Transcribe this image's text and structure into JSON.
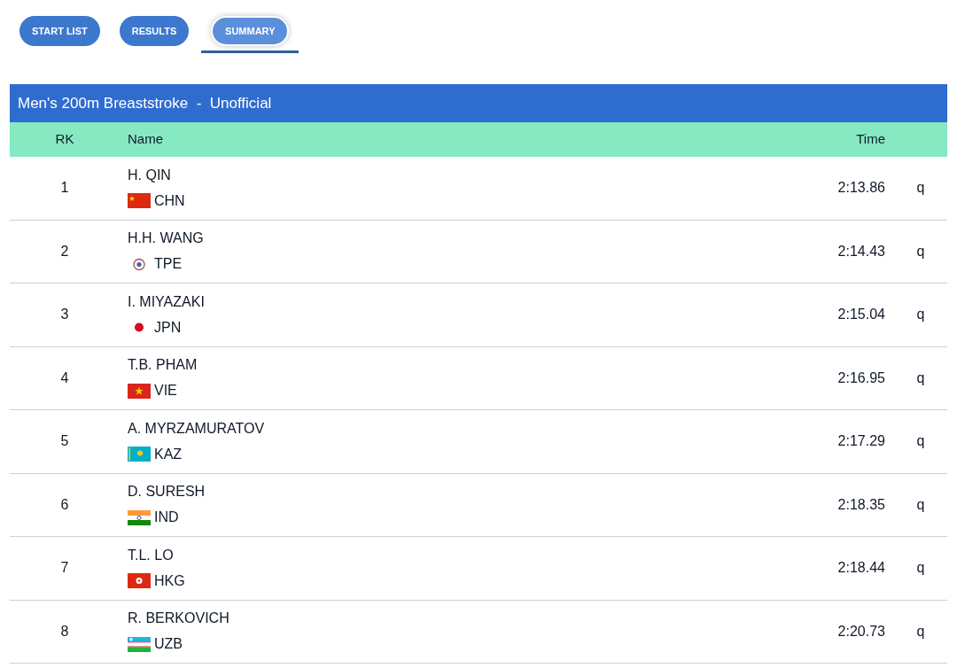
{
  "tabs": [
    {
      "label": "START LIST",
      "selected": false
    },
    {
      "label": "RESULTS",
      "selected": false
    },
    {
      "label": "SUMMARY",
      "selected": true
    }
  ],
  "table": {
    "title": "Men's 200m Breaststroke  -  Unofficial",
    "columns": [
      "RK",
      "Name",
      "Time"
    ],
    "rows": [
      {
        "rank": "1",
        "name": "H. QIN",
        "kind": "chn",
        "country": "CHN",
        "time": "2:13.86",
        "qualifier": "q"
      },
      {
        "rank": "2",
        "name": "H.H. WANG",
        "kind": "tpe",
        "country": "TPE",
        "time": "2:14.43",
        "qualifier": "q"
      },
      {
        "rank": "3",
        "name": "I. MIYAZAKI",
        "kind": "jpn",
        "country": "JPN",
        "time": "2:15.04",
        "qualifier": "q"
      },
      {
        "rank": "4",
        "name": "T.B. PHAM",
        "kind": "vie",
        "country": "VIE",
        "time": "2:16.95",
        "qualifier": "q"
      },
      {
        "rank": "5",
        "name": "A. MYRZAMURATOV",
        "kind": "kaz",
        "country": "KAZ",
        "time": "2:17.29",
        "qualifier": "q"
      },
      {
        "rank": "6",
        "name": "D. SURESH",
        "kind": "ind",
        "country": "IND",
        "time": "2:18.35",
        "qualifier": "q"
      },
      {
        "rank": "7",
        "name": "T.L. LO",
        "kind": "hkg",
        "country": "HKG",
        "time": "2:18.44",
        "qualifier": "q"
      },
      {
        "rank": "8",
        "name": "R. BERKOVICH",
        "kind": "uzb",
        "country": "UZB",
        "time": "2:20.73",
        "qualifier": "q"
      }
    ]
  }
}
